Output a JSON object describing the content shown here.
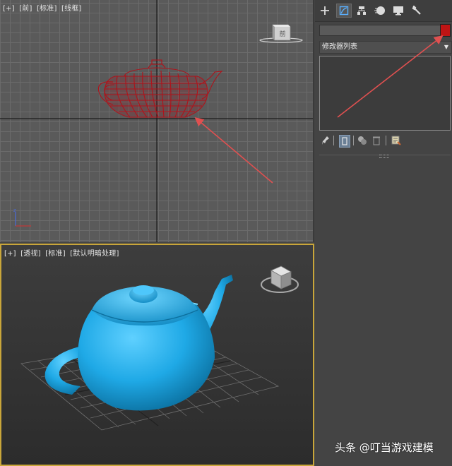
{
  "viewport_front": {
    "labels": [
      "[+]",
      "[前]",
      "[标准]",
      "[线框]"
    ],
    "viewcube_text": "前"
  },
  "viewport_perspective": {
    "labels": [
      "[+]",
      "[透视]",
      "[标准]",
      "[默认明暗处理]"
    ]
  },
  "command_panel": {
    "tabs": [
      {
        "icon": "create-plus-icon"
      },
      {
        "icon": "modify-icon",
        "active": true
      },
      {
        "icon": "hierarchy-icon"
      },
      {
        "icon": "motion-icon"
      },
      {
        "icon": "display-icon"
      },
      {
        "icon": "utilities-wrench-icon"
      }
    ],
    "object_name": "",
    "object_color": "#c01414",
    "modifier_list_label": "修改器列表"
  },
  "watermark": "头条 @叮当游戏建模",
  "colors": {
    "wireframe": "#b0121a",
    "teapot": "#1fa9e6",
    "active_border": "#c9a63a",
    "annotation_arrow": "#e05050"
  }
}
